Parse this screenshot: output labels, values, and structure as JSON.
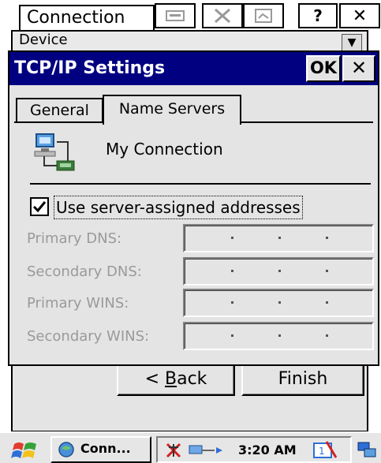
{
  "background_window": {
    "title": "Connection",
    "help_label": "?",
    "close_label": "✕",
    "device_field": "Device",
    "back_label_prefix": "< ",
    "back_label_accel": "B",
    "back_label_rest": "ack",
    "finish_label": "Finish"
  },
  "dialog": {
    "title": "TCP/IP Settings",
    "ok_label": "OK",
    "close_label": "✕",
    "tabs": [
      {
        "label": "General",
        "active": false
      },
      {
        "label": "Name Servers",
        "active": true
      }
    ],
    "connection_name": "My Connection",
    "use_server_assigned": {
      "checked": true,
      "label": "Use server-assigned addresses"
    },
    "fields": [
      {
        "label": "Primary DNS:",
        "value": [
          "",
          "",
          "",
          ""
        ],
        "enabled": false
      },
      {
        "label": "Secondary DNS:",
        "value": [
          "",
          "",
          "",
          ""
        ],
        "enabled": false
      },
      {
        "label": "Primary WINS:",
        "value": [
          "",
          "",
          "",
          ""
        ],
        "enabled": false
      },
      {
        "label": "Secondary WINS:",
        "value": [
          "",
          "",
          "",
          ""
        ],
        "enabled": false
      }
    ]
  },
  "taskbar": {
    "task_label": "Conn...",
    "time": "3:20 AM",
    "icons": [
      "start-flag-icon",
      "connection-task-icon",
      "network-status-icon",
      "keyboard-input-icon",
      "desktop-icon"
    ]
  },
  "colors": {
    "titlebar": "#000080",
    "window_bg": "#e4e4e4",
    "disabled_text": "#9a9a9a"
  }
}
